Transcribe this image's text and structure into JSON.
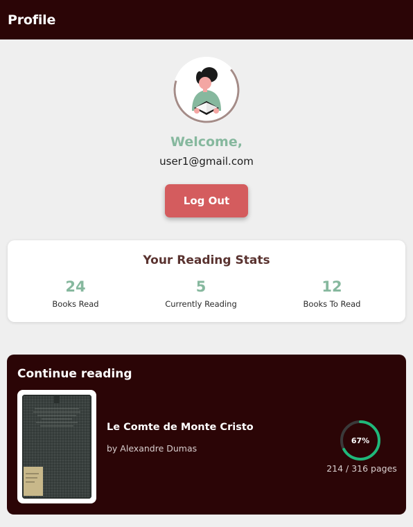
{
  "header": {
    "title": "Profile"
  },
  "profile": {
    "welcome": "Welcome,",
    "email": "user1@gmail.com",
    "logout_label": "Log Out"
  },
  "stats": {
    "title": "Your Reading Stats",
    "items": [
      {
        "value": "24",
        "label": "Books Read"
      },
      {
        "value": "5",
        "label": "Currently Reading"
      },
      {
        "value": "12",
        "label": "Books To Read"
      }
    ]
  },
  "continue_reading": {
    "title": "Continue reading",
    "book": {
      "title": "Le Comte de Monte Cristo",
      "author": "by Alexandre Dumas",
      "progress_label": "67%",
      "progress_fraction": 0.67,
      "pages_label": "214 / 316 pages"
    }
  },
  "colors": {
    "header_bg": "#2b0506",
    "accent_green": "#86b89e",
    "logout_red": "#d45c5e",
    "progress_green": "#1fb87a"
  }
}
